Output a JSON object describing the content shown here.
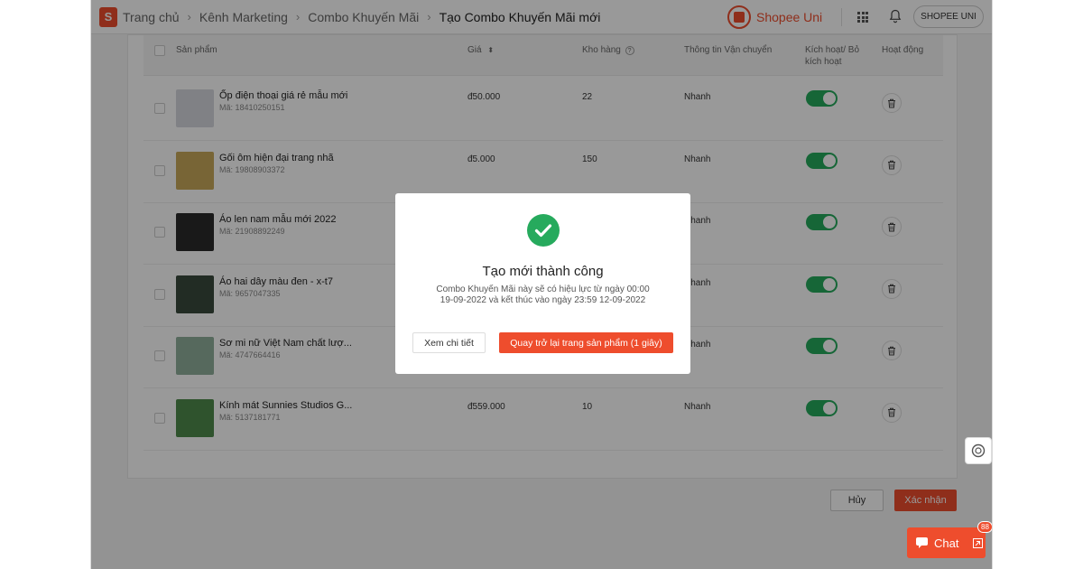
{
  "breadcrumb": [
    "Trang chủ",
    "Kênh Marketing",
    "Combo Khuyến Mãi",
    "Tạo Combo Khuyến Mãi mới"
  ],
  "brand": {
    "logo_letter": "S",
    "name": "Shopee Uni"
  },
  "header": {
    "account_label": "SHOPEE UNI"
  },
  "table": {
    "headers": {
      "product": "Sản phẩm",
      "price": "Giá",
      "price_sort_icon": "sort-icon",
      "stock": "Kho hàng",
      "shipping": "Thông tin Vận chuyển",
      "activate": "Kích hoạt/ Bỏ kích hoạt",
      "action": "Hoạt động"
    },
    "rows": [
      {
        "name": "Ốp điện thoại giá rẻ mẫu mới",
        "code": "Mã: 18410250151",
        "price": "đ50.000",
        "stock": "22",
        "shipping": "Nhanh",
        "active": true,
        "thumb_color": "#d6d8de"
      },
      {
        "name": "Gối ôm hiện đại trang nhã",
        "code": "Mã: 19808903372",
        "price": "đ5.000",
        "stock": "150",
        "shipping": "Nhanh",
        "active": true,
        "thumb_color": "#c9a85a"
      },
      {
        "name": "Áo len nam mẫu mới 2022",
        "code": "Mã: 21908892249",
        "price": "",
        "stock": "",
        "shipping": "Nhanh",
        "active": true,
        "thumb_color": "#2b2b2b"
      },
      {
        "name": "Áo hai dây màu đen - x-t7",
        "code": "Mã: 9657047335",
        "price": "",
        "stock": "",
        "shipping": "Nhanh",
        "active": true,
        "thumb_color": "#3a4a3c"
      },
      {
        "name": "Sơ mi nữ Việt Nam chất lượ...",
        "code": "Mã: 4747664416",
        "price": "",
        "stock": "",
        "shipping": "Nhanh",
        "active": true,
        "thumb_color": "#8fb09b"
      },
      {
        "name": "Kính mát Sunnies Studios G...",
        "code": "Mã: 5137181771",
        "price": "đ559.000",
        "stock": "10",
        "shipping": "Nhanh",
        "active": true,
        "thumb_color": "#4f8a4c"
      }
    ]
  },
  "footer": {
    "cancel_label": "Hủy",
    "confirm_label": "Xác nhận"
  },
  "modal": {
    "title": "Tạo mới thành công",
    "message": "Combo Khuyến Mãi này sẽ có hiệu lực từ ngày 00:00 19-09-2022 và kết thúc vào ngày 23:59 12-09-2022",
    "detail_label": "Xem chi tiết",
    "back_label": "Quay trở lại trang sản phẩm (1 giây)"
  },
  "chat": {
    "label": "Chat",
    "badge": "88"
  },
  "colors": {
    "accent": "#ee4d2d",
    "success": "#26aa5d"
  }
}
